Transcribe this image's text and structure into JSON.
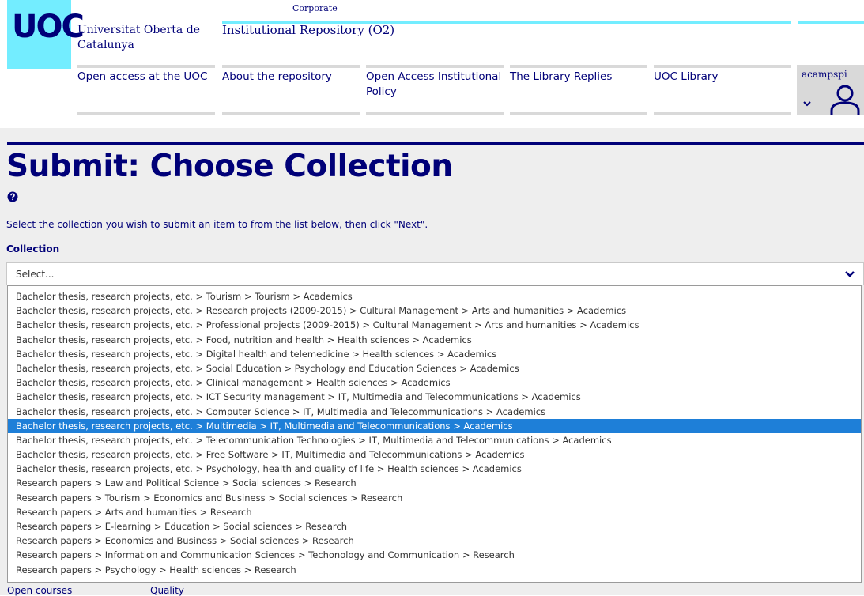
{
  "header": {
    "logo_text": "UOC",
    "university_name": "Universitat Oberta de Catalunya",
    "corporate_label": "Corporate",
    "repository_title": "Institutional Repository (O2)",
    "nav": [
      "Open access at the UOC",
      "About the repository",
      "Open Access Institutional Policy",
      "The Library Replies",
      "UOC Library"
    ],
    "user": {
      "name": "acampspi",
      "icon": "user-icon"
    }
  },
  "main": {
    "title": "Submit: Choose Collection",
    "help_icon": "question-circle-icon",
    "instructions": "Select the collection you wish to submit an item to from the list below, then click \"Next\".",
    "collection_label": "Collection",
    "select": {
      "value": "Select...",
      "options": [
        "Bachelor thesis, research projects, etc. > Tourism > Tourism > Academics",
        "Bachelor thesis, research projects, etc. > Research projects (2009-2015) > Cultural Management > Arts and humanities > Academics",
        "Bachelor thesis, research projects, etc. > Professional projects (2009-2015) > Cultural Management > Arts and humanities > Academics",
        "Bachelor thesis, research projects, etc. > Food, nutrition and health > Health sciences > Academics",
        "Bachelor thesis, research projects, etc. > Digital health and telemedicine > Health sciences > Academics",
        "Bachelor thesis, research projects, etc. > Social Education > Psychology and Education Sciences > Academics",
        "Bachelor thesis, research projects, etc. > Clinical management > Health sciences > Academics",
        "Bachelor thesis, research projects, etc. > ICT Security management > IT, Multimedia and Telecommunications > Academics",
        "Bachelor thesis, research projects, etc. > Computer Science > IT, Multimedia and Telecommunications > Academics",
        "Bachelor thesis, research projects, etc. > Multimedia > IT, Multimedia and Telecommunications > Academics",
        "Bachelor thesis, research projects, etc. > Telecommunication Technologies > IT, Multimedia and Telecommunications > Academics",
        "Bachelor thesis, research projects, etc. > Free Software > IT, Multimedia and Telecommunications > Academics",
        "Bachelor thesis, research projects, etc. > Psychology, health and quality of life > Health sciences > Academics",
        "Research papers > Law and Political Science > Social sciences > Research",
        "Research papers > Tourism > Economics and Business > Social sciences > Research",
        "Research papers > Arts and humanities > Research",
        "Research papers > E-learning > Education > Social sciences > Research",
        "Research papers > Economics and Business > Social sciences > Research",
        "Research papers > Information and Communication Sciences > Techonology and Communication > Research",
        "Research papers > Psychology > Health sciences > Research"
      ],
      "highlighted_index": 9
    }
  },
  "footer": {
    "links": [
      "Open courses",
      "Quality"
    ]
  },
  "colors": {
    "brand_navy": "#000078",
    "brand_cyan": "#73edff",
    "highlight": "#1e7fd8",
    "nav_gray": "#d9d9d9",
    "page_bg": "#eeeeee"
  }
}
